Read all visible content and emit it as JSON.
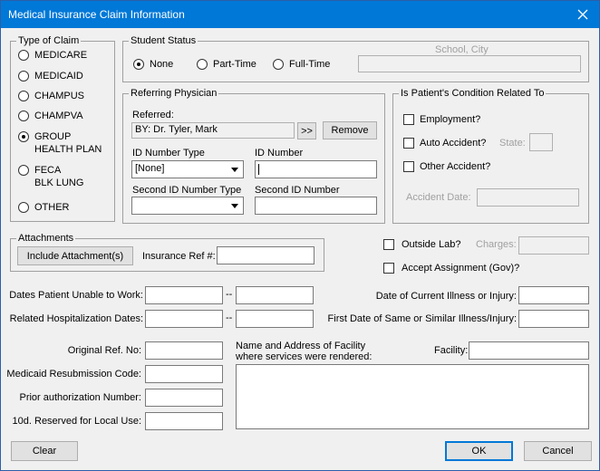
{
  "window": {
    "title": "Medical Insurance Claim Information"
  },
  "type_of_claim": {
    "legend": "Type of Claim",
    "options": [
      {
        "line1": "MEDICARE",
        "line2": "",
        "selected": false
      },
      {
        "line1": "MEDICAID",
        "line2": "",
        "selected": false
      },
      {
        "line1": "CHAMPUS",
        "line2": "",
        "selected": false
      },
      {
        "line1": "CHAMPVA",
        "line2": "",
        "selected": false
      },
      {
        "line1": "GROUP",
        "line2": "HEALTH PLAN",
        "selected": true
      },
      {
        "line1": "FECA",
        "line2": "BLK LUNG",
        "selected": false
      },
      {
        "line1": "OTHER",
        "line2": "",
        "selected": false
      }
    ]
  },
  "student_status": {
    "legend": "Student Status",
    "options": [
      {
        "label": "None",
        "selected": true
      },
      {
        "label": "Part-Time",
        "selected": false
      },
      {
        "label": "Full-Time",
        "selected": false
      }
    ],
    "school_city_label": "School, City",
    "school_city_value": ""
  },
  "referring_physician": {
    "legend": "Referring Physician",
    "referred_label": "Referred:",
    "referred_value": "BY:  Dr. Tyler, Mark",
    "browse_label": ">>",
    "remove_label": "Remove",
    "id_number_type_label": "ID Number Type",
    "id_number_type_value": "[None]",
    "id_number_label": "ID Number",
    "id_number_value": "",
    "second_id_type_label": "Second ID Number Type",
    "second_id_type_value": "",
    "second_id_label": "Second ID Number",
    "second_id_value": ""
  },
  "condition": {
    "legend": "Is Patient's Condition Related To",
    "employment": "Employment?",
    "auto_accident": "Auto Accident?",
    "state_label": "State:",
    "other_accident": "Other Accident?",
    "accident_date_label": "Accident Date:"
  },
  "attachments": {
    "legend": "Attachments",
    "include_label": "Include Attachment(s)",
    "insurance_ref_label": "Insurance Ref #:",
    "insurance_ref_value": ""
  },
  "outside_lab": {
    "label": "Outside Lab?",
    "charges_label": "Charges:"
  },
  "accept_assignment": {
    "label": "Accept Assignment (Gov)?"
  },
  "dates": {
    "unable_to_work_label": "Dates Patient Unable to Work:",
    "hospitalization_label": "Related Hospitalization Dates:",
    "separator": "--",
    "current_illness_label": "Date of Current Illness or Injury:",
    "first_date_label": "First Date of Same or Similar Illness/Injury:"
  },
  "refs": {
    "original_ref_label": "Original Ref. No:",
    "medicaid_resub_label": "Medicaid Resubmission Code:",
    "prior_auth_label": "Prior authorization Number:",
    "reserved_label": "10d. Reserved for Local Use:"
  },
  "facility": {
    "name_address_line1": "Name and Address of Facility",
    "name_address_line2": "where services were rendered:",
    "facility_label": "Facility:"
  },
  "buttons": {
    "clear": "Clear",
    "ok": "OK",
    "cancel": "Cancel"
  },
  "colors": {
    "title_bar": "#0078d7",
    "background": "#f0f0f0",
    "default_button_border": "#0078d7"
  }
}
